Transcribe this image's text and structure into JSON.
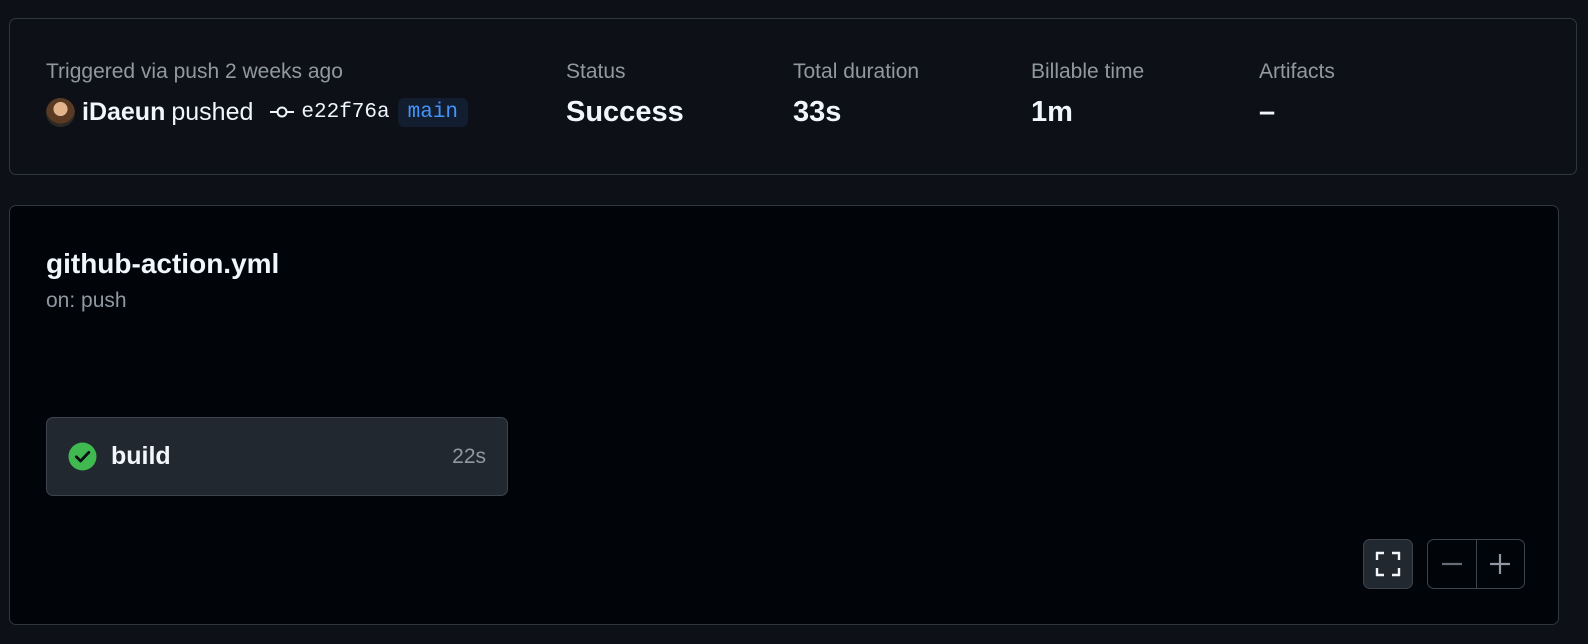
{
  "summary": {
    "trigger_label": "Triggered via push 2 weeks ago",
    "pusher": "iDaeun",
    "pushed_text": "pushed",
    "commit_sha": "e22f76a",
    "branch": "main",
    "status_label": "Status",
    "status_value": "Success",
    "duration_label": "Total duration",
    "duration_value": "33s",
    "billable_label": "Billable time",
    "billable_value": "1m",
    "artifacts_label": "Artifacts",
    "artifacts_value": "–"
  },
  "workflow": {
    "file": "github-action.yml",
    "trigger": "on: push",
    "jobs": [
      {
        "name": "build",
        "duration": "22s",
        "status": "success",
        "status_icon": "check-circle-icon"
      }
    ]
  },
  "controls": {
    "fullscreen_icon": "fullscreen-icon",
    "zoom_out_icon": "zoom-out-icon",
    "zoom_in_icon": "zoom-in-icon"
  },
  "colors": {
    "background": "#0d1117",
    "canvas": "#010409",
    "success": "#3fb950",
    "branch": "#4493f8",
    "muted": "#9198a1"
  }
}
